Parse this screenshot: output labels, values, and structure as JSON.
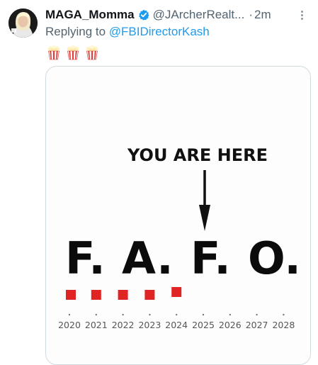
{
  "tweet": {
    "display_name": "MAGA_Momma",
    "verified": true,
    "handle": "@JArcherRealt...",
    "separator": "·",
    "time": "2m",
    "reply_prefix": "Replying to ",
    "reply_mention": "@FBIDirectorKash",
    "emojis": [
      "popcorn",
      "popcorn",
      "popcorn"
    ]
  },
  "colors": {
    "link": "#1d9bf0",
    "verified": "#1d9bf0",
    "secondary_text": "#536471",
    "marker": "#e02424"
  },
  "image": {
    "headline": "YOU ARE HERE",
    "letters": [
      "F.",
      "A.",
      "F.",
      "O."
    ],
    "marker_label_years": [
      "2020",
      "2021",
      "2022",
      "2023",
      "2024"
    ],
    "years": [
      "2020",
      "2021",
      "2022",
      "2023",
      "2024",
      "2025",
      "2026",
      "2027",
      "2028"
    ],
    "arrow_points_to_year": "2025"
  }
}
